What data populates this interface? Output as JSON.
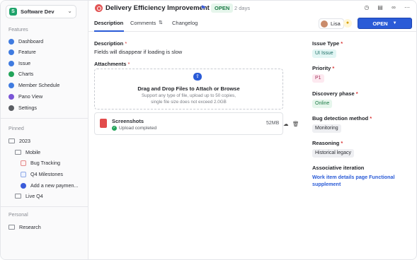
{
  "workspace": {
    "name": "Software Dev",
    "logo_letter": "S"
  },
  "sidebar": {
    "features_label": "Features",
    "features": [
      {
        "label": "Dashboard",
        "color": "#3f7be0"
      },
      {
        "label": "Feature",
        "color": "#3f7be0"
      },
      {
        "label": "Issue",
        "color": "#3f7be0"
      },
      {
        "label": "Charts",
        "color": "#22a45a"
      },
      {
        "label": "Member Schedule",
        "color": "#3f7be0"
      },
      {
        "label": "Pano View",
        "color": "#7a55d6"
      },
      {
        "label": "Settings",
        "color": "#5a5d63"
      }
    ],
    "pinned_label": "Pinned",
    "pinned": [
      {
        "label": "2023"
      },
      {
        "label": "Mobile"
      },
      {
        "label": "Bug Tracking"
      },
      {
        "label": "Q4 Milestones"
      },
      {
        "label": "Add a new paymen..."
      },
      {
        "label": "Live Q4"
      }
    ],
    "personal_label": "Personal",
    "personal": [
      {
        "label": "Research"
      }
    ]
  },
  "header": {
    "title": "Delivery Efficiency Improvement",
    "status": "OPEN",
    "age": "2 days"
  },
  "tabs": [
    {
      "label": "Description"
    },
    {
      "label": "Comments"
    },
    {
      "label": "Changelog"
    }
  ],
  "assignee": {
    "name": "Lisa"
  },
  "open_button": {
    "label": "OPEN"
  },
  "description": {
    "label": "Description",
    "text": "Fields will disappear if loading is slow"
  },
  "attachments": {
    "label": "Attachments",
    "dropzone_title": "Drag and Drop Files to Attach or Browse",
    "dropzone_sub": "Support any type of file, upload up to 50 copies, single file size does not exceed 2.0GB",
    "file": {
      "name": "Screenshots",
      "status": "Upload completed",
      "size": "52MB"
    }
  },
  "fields": {
    "issue_type": {
      "label": "Issue Type",
      "value": "UI Issue",
      "color": "#e2f6f4"
    },
    "priority": {
      "label": "Priority",
      "value": "P1",
      "color": "#fde9f0"
    },
    "discovery_phase": {
      "label": "Discovery phase",
      "value": "Online",
      "color": "#e6f6ec"
    },
    "bug_detection": {
      "label": "Bug detection method",
      "value": "Monitoring",
      "color": "#eeeff2"
    },
    "reasoning": {
      "label": "Reasoning",
      "value": "Historical legacy",
      "color": "#eeeff2"
    },
    "association": {
      "label": "Associative iteration",
      "value": "Work item details page Functional supplement"
    }
  }
}
